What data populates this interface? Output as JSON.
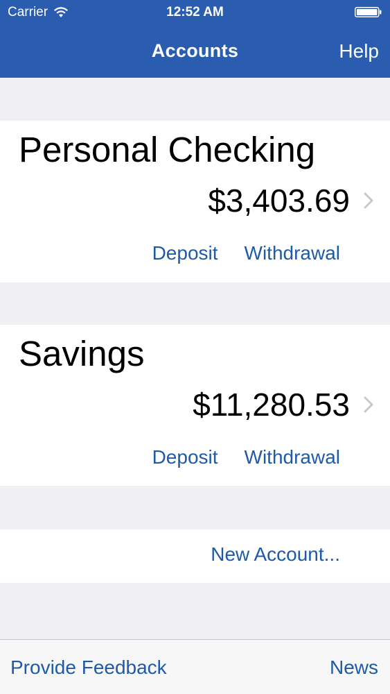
{
  "status_bar": {
    "carrier": "Carrier",
    "time": "12:52 AM",
    "wifi_icon": "wifi-icon",
    "battery_icon": "battery-icon"
  },
  "nav": {
    "title": "Accounts",
    "help_label": "Help"
  },
  "accounts": [
    {
      "name": "Personal Checking",
      "balance": "$3,403.69",
      "deposit_label": "Deposit",
      "withdrawal_label": "Withdrawal",
      "chevron_icon": "chevron-right-icon"
    },
    {
      "name": "Savings",
      "balance": "$11,280.53",
      "deposit_label": "Deposit",
      "withdrawal_label": "Withdrawal",
      "chevron_icon": "chevron-right-icon"
    }
  ],
  "new_account_label": "New Account...",
  "toolbar": {
    "feedback_label": "Provide Feedback",
    "news_label": "News"
  },
  "colors": {
    "nav_bar": "#2a5db0",
    "link": "#1f5aa6",
    "background": "#efeff4",
    "card": "#ffffff"
  }
}
